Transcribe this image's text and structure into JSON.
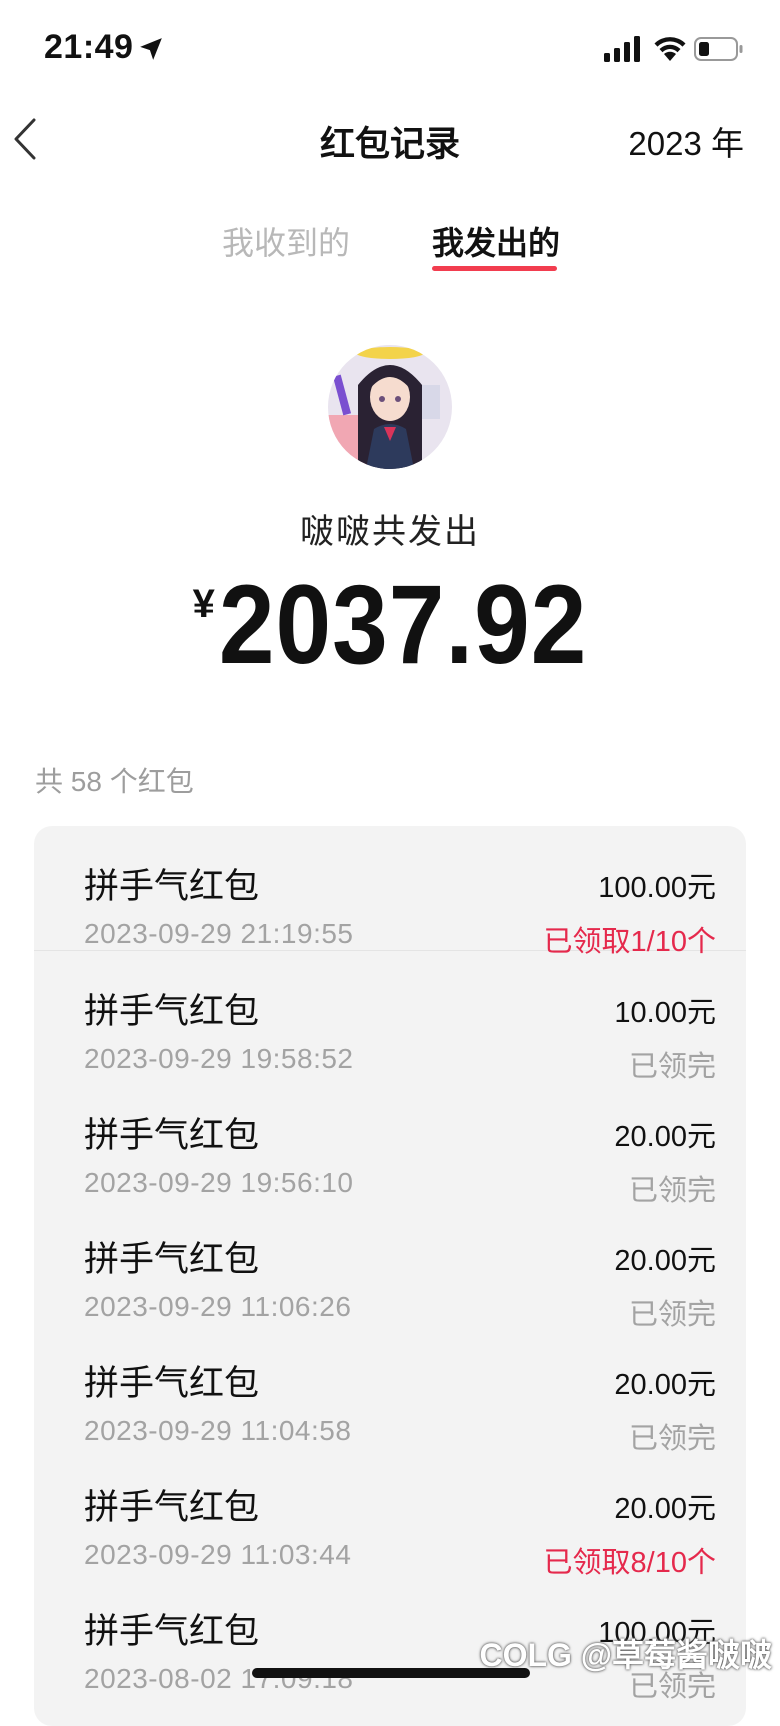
{
  "status_bar": {
    "time": "21:49"
  },
  "nav": {
    "title": "红包记录",
    "year": "2023 年"
  },
  "tabs": {
    "received": "我收到的",
    "sent": "我发出的"
  },
  "summary": {
    "caption": "啵啵共发出",
    "currency_symbol": "¥",
    "total_amount": "2037.92",
    "count_label": "共 58 个红包"
  },
  "records": [
    {
      "title": "拼手气红包",
      "time": "2023-09-29 21:19:55",
      "amount": "100.00元",
      "status": "已领取1/10个",
      "status_color": "#e5294c"
    },
    {
      "title": "拼手气红包",
      "time": "2023-09-29 19:58:52",
      "amount": "10.00元",
      "status": "已领完",
      "status_color": "#a3a3a3"
    },
    {
      "title": "拼手气红包",
      "time": "2023-09-29 19:56:10",
      "amount": "20.00元",
      "status": "已领完",
      "status_color": "#a3a3a3"
    },
    {
      "title": "拼手气红包",
      "time": "2023-09-29 11:06:26",
      "amount": "20.00元",
      "status": "已领完",
      "status_color": "#a3a3a3"
    },
    {
      "title": "拼手气红包",
      "time": "2023-09-29 11:04:58",
      "amount": "20.00元",
      "status": "已领完",
      "status_color": "#a3a3a3"
    },
    {
      "title": "拼手气红包",
      "time": "2023-09-29 11:03:44",
      "amount": "20.00元",
      "status": "已领取8/10个",
      "status_color": "#e5294c"
    },
    {
      "title": "拼手气红包",
      "time": "2023-08-02 17:09:18",
      "amount": "100.00元",
      "status": "已领完",
      "status_color": "#a3a3a3"
    }
  ],
  "watermark": "COLG @草莓酱啵啵",
  "colors": {
    "accent": "#f23d4f",
    "status_red": "#e5294c",
    "muted": "#a3a3a3"
  }
}
